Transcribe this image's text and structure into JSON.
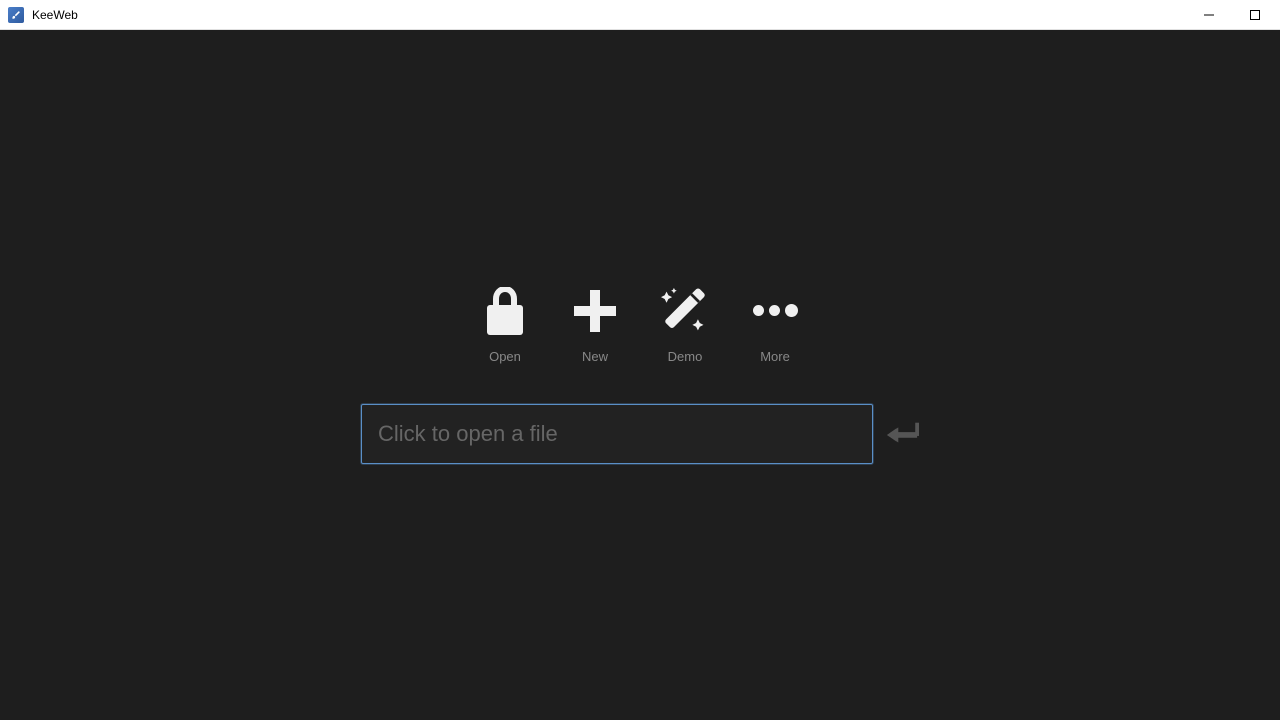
{
  "titlebar": {
    "title": "KeeWeb"
  },
  "actions": {
    "open": "Open",
    "new": "New",
    "demo": "Demo",
    "more": "More"
  },
  "input": {
    "placeholder": "Click to open a file"
  }
}
